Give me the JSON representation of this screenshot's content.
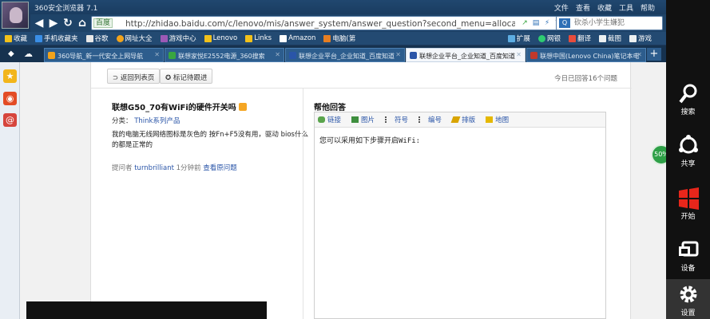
{
  "window": {
    "app_title": "360安全浏览器 7.1",
    "menu": [
      "文件",
      "查看",
      "收藏",
      "工具",
      "帮助"
    ]
  },
  "nav": {
    "url": "http://zhidao.baidu.com/c/lenovo/mis/answer_system/answer_question?second_menu=allocated_ques",
    "engine_label": "百度",
    "search_placeholder": "砍杀小学生嫌犯"
  },
  "bookmarks": [
    "收藏",
    "手机收藏夹",
    "谷歌",
    "网址大全",
    "游戏中心",
    "Lenovo",
    "Links",
    "Amazon",
    "电脑(第"
  ],
  "bookmarks_right": [
    "扩展",
    "网银",
    "翻译",
    "截图",
    "游戏"
  ],
  "tabs": [
    {
      "label": "360导航_新一代安全上网导航",
      "color": "#f2a31b",
      "active": false
    },
    {
      "label": "联想家悦E2552电源_360搜索",
      "color": "#39a640",
      "active": false
    },
    {
      "label": "联想企业平台_企业知道_百度知道",
      "color": "#2a55a8",
      "active": false
    },
    {
      "label": "联想企业平台_企业知道_百度知道",
      "color": "#2a55a8",
      "active": true
    },
    {
      "label": "联想中国(Lenovo China)笔记本电",
      "color": "#c0392b",
      "active": false
    }
  ],
  "page": {
    "back_button": "返回列表页",
    "mark_button": "标记待跟进",
    "today_count": "今日已回答16个问题"
  },
  "question": {
    "title": "联想G50_70有WiFi的硬件开关吗",
    "category_label": "分类：",
    "category_value": "Think系列产品",
    "body": "我的电脑无线网络图标是灰色的 按Fn+F5没有用，驱动 bios什么的都是正常的",
    "asker_label": "提问者",
    "asker_name": "turnbrilliant",
    "time": "1分钟前",
    "view_original": "查看原问题"
  },
  "answer": {
    "title": "帮他回答",
    "toolbar": [
      "链接",
      "图片",
      "符号",
      "编号",
      "排版",
      "地图"
    ],
    "content": "您可以采用如下步骤开启WiFi:"
  },
  "float_badge": "50%",
  "charms": [
    "搜索",
    "共享",
    "开始",
    "设备",
    "设置"
  ]
}
